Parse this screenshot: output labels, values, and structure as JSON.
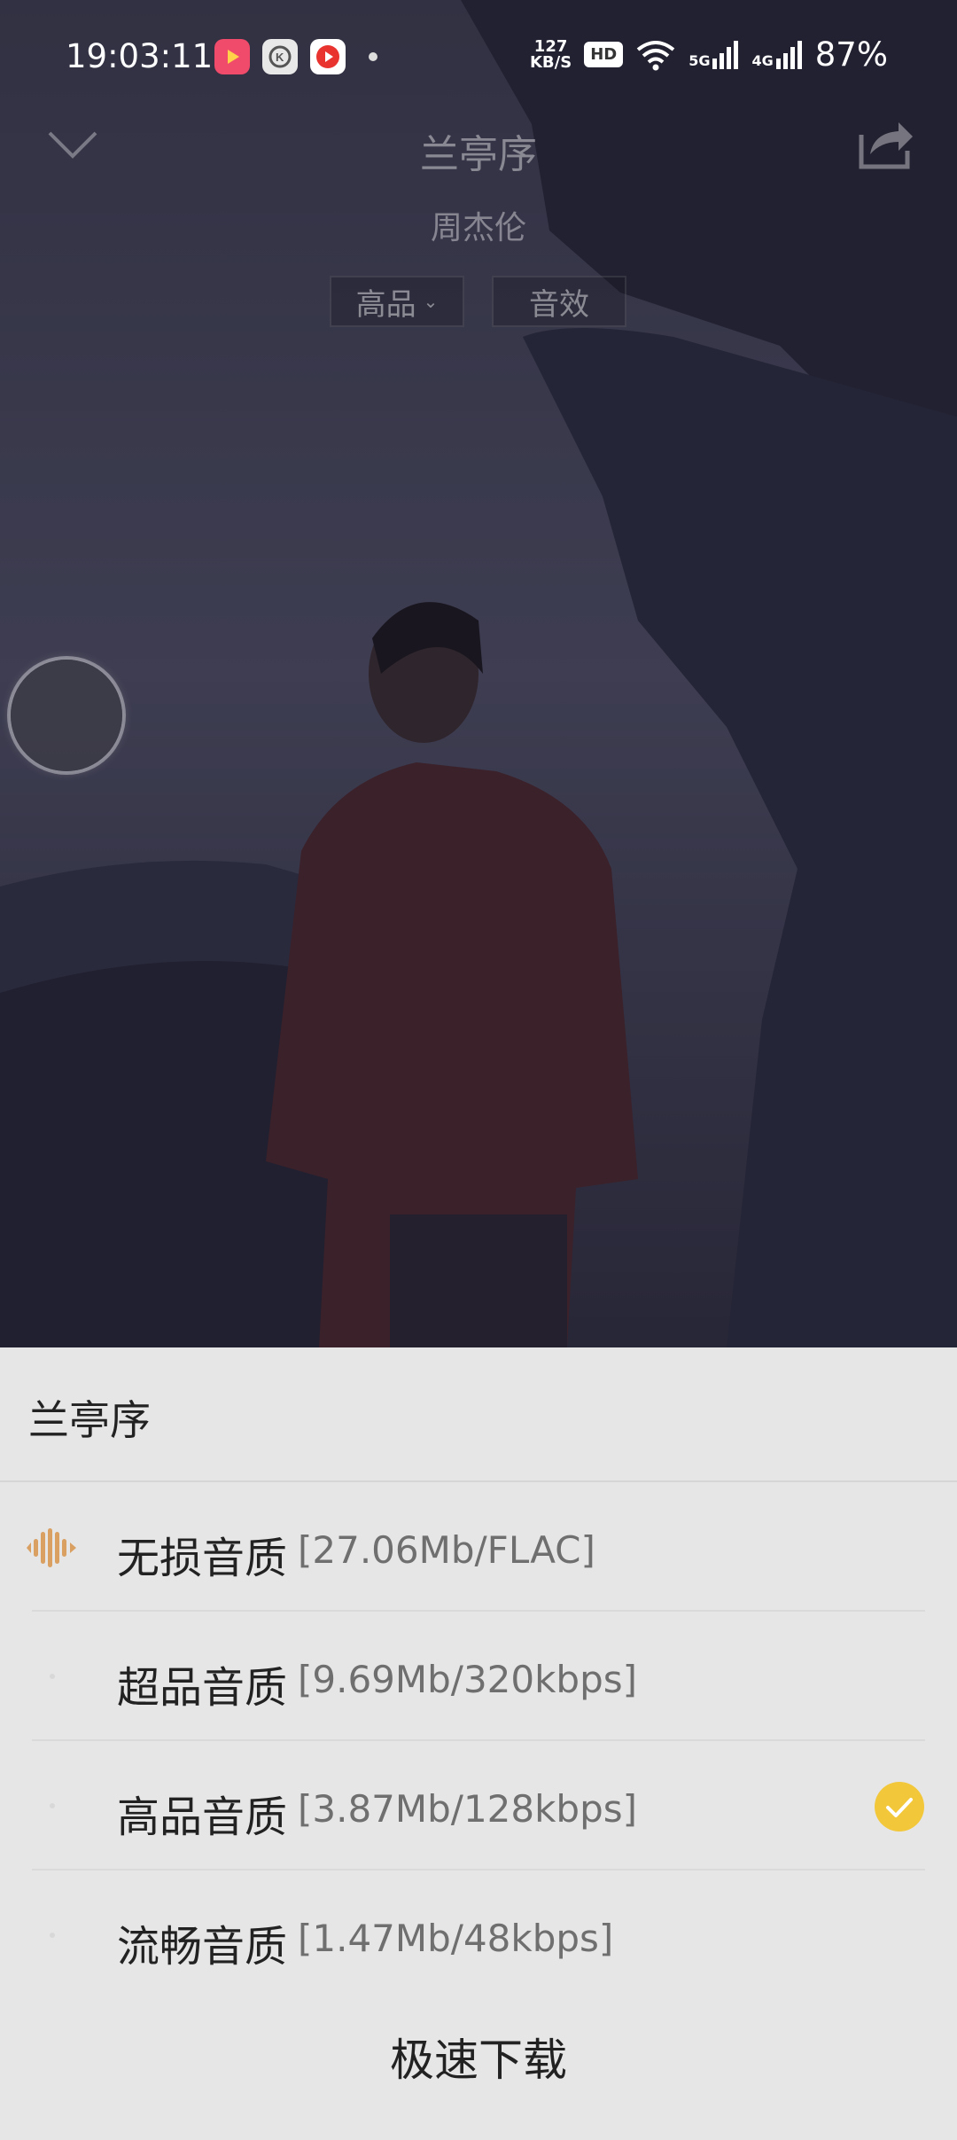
{
  "status_bar": {
    "time": "19:03:11",
    "net_speed_value": "127",
    "net_speed_unit": "KB/S",
    "hd_badge": "HD",
    "signal_1": "5G",
    "signal_2": "4G",
    "battery": "87%"
  },
  "player": {
    "song_title": "兰亭序",
    "artist": "周杰伦",
    "quality_button": "高品",
    "effect_button": "音效"
  },
  "sheet": {
    "title": "兰亭序",
    "options": [
      {
        "label": "无损音质",
        "size": "[27.06Mb/FLAC]",
        "icon": "sound-wave-icon",
        "selected": false
      },
      {
        "label": "超品音质",
        "size": "[9.69Mb/320kbps]",
        "selected": false
      },
      {
        "label": "高品音质",
        "size": "[3.87Mb/128kbps]",
        "selected": true
      },
      {
        "label": "流畅音质",
        "size": "[1.47Mb/48kbps]",
        "selected": false
      }
    ],
    "action": "极速下载"
  },
  "colors": {
    "accent_gold": "#f2c73a",
    "lossless_orange": "#d9a062",
    "sheet_bg": "#e6e6e6"
  }
}
